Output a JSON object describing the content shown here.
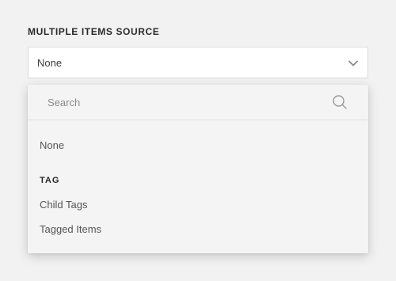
{
  "field": {
    "label": "MULTIPLE ITEMS SOURCE",
    "selected_value": "None"
  },
  "dropdown": {
    "search_placeholder": "Search",
    "options": [
      {
        "label": "None"
      }
    ],
    "groups": [
      {
        "label": "TAG",
        "options": [
          {
            "label": "Child Tags"
          },
          {
            "label": "Tagged Items"
          }
        ]
      }
    ]
  },
  "icons": {
    "chevron": "chevron-down-icon",
    "search": "search-icon"
  },
  "colors": {
    "background": "#f2f2f2",
    "select_bg": "#ffffff",
    "dropdown_bg": "#f4f4f4",
    "text": "#555555",
    "label": "#2a2a2a"
  }
}
